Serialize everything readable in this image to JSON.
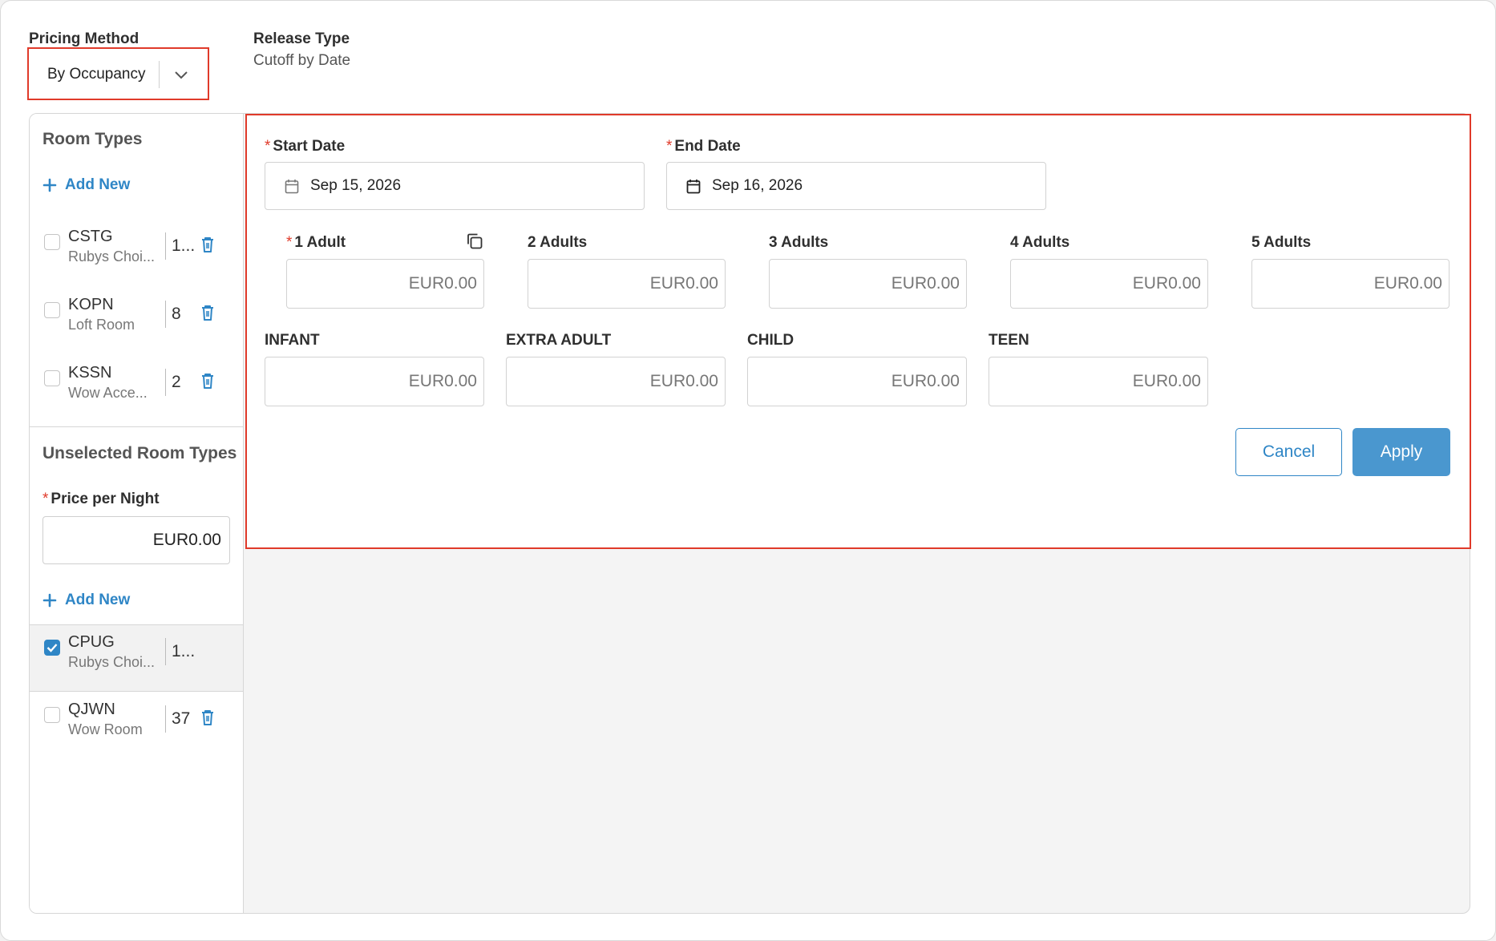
{
  "header": {
    "pricing_method_label": "Pricing Method",
    "pricing_method_value": "By Occupancy",
    "release_type_label": "Release Type",
    "release_type_value": "Cutoff by Date"
  },
  "sidebar": {
    "room_types_title": "Room Types",
    "add_new_label": "Add New",
    "room_types": [
      {
        "code": "CSTG",
        "name": "Rubys Choi...",
        "count": "1...",
        "checked": false
      },
      {
        "code": "KOPN",
        "name": "Loft Room",
        "count": "8",
        "checked": false
      },
      {
        "code": "KSSN",
        "name": "Wow Acce...",
        "count": "2",
        "checked": false
      }
    ],
    "unselected_title": "Unselected Room Types",
    "price_per_night_label": "Price per Night",
    "price_per_night_value": "EUR0.00",
    "add_new_label_2": "Add New",
    "unselected_rooms": [
      {
        "code": "CPUG",
        "name": "Rubys Choi...",
        "count": "1...",
        "checked": true
      },
      {
        "code": "QJWN",
        "name": "Wow Room",
        "count": "37",
        "checked": false
      }
    ]
  },
  "editor": {
    "start_date_label": "Start Date",
    "start_date_value": "Sep 15, 2026",
    "end_date_label": "End Date",
    "end_date_value": "Sep 16, 2026",
    "occupancy": [
      {
        "label": "1 Adult",
        "value": "EUR0.00",
        "required": true
      },
      {
        "label": "2 Adults",
        "value": "EUR0.00"
      },
      {
        "label": "3 Adults",
        "value": "EUR0.00"
      },
      {
        "label": "4 Adults",
        "value": "EUR0.00"
      },
      {
        "label": "5 Adults",
        "value": "EUR0.00"
      }
    ],
    "extras": [
      {
        "label": "INFANT",
        "value": "EUR0.00"
      },
      {
        "label": "EXTRA ADULT",
        "value": "EUR0.00"
      },
      {
        "label": "CHILD",
        "value": "EUR0.00"
      },
      {
        "label": "TEEN",
        "value": "EUR0.00"
      }
    ],
    "cancel_label": "Cancel",
    "apply_label": "Apply"
  },
  "icons": {
    "chevron": "chevron-down-icon",
    "calendar": "calendar-icon",
    "plus": "plus-icon",
    "trash": "trash-icon",
    "copy": "copy-icon",
    "check": "checkmark-icon"
  },
  "colors": {
    "accent": "#2f86c6",
    "apply_button": "#4a97cf",
    "highlight_border": "#e03a2a",
    "required_marker": "#e03a2a"
  }
}
